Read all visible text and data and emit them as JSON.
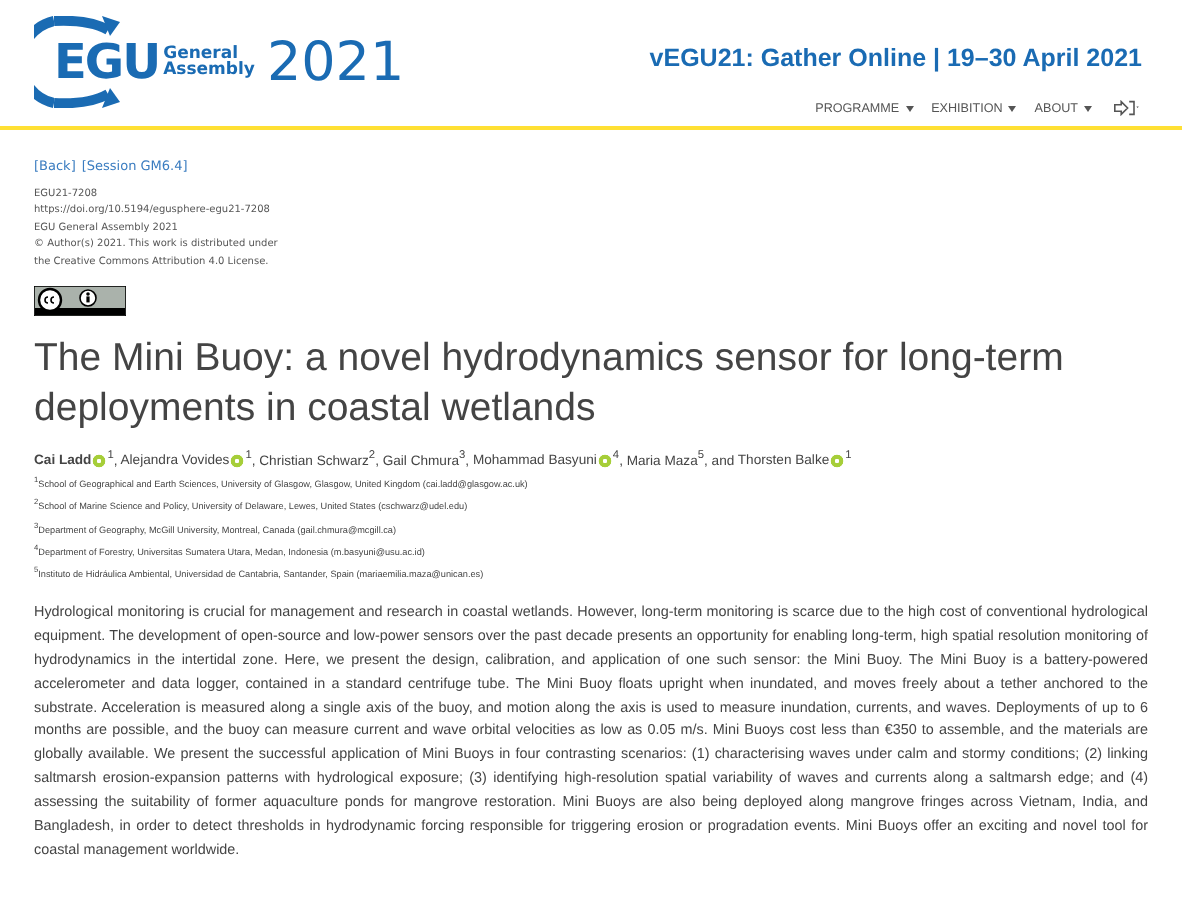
{
  "logo": {
    "letters": "EGU",
    "line_1": "General",
    "line_2": "Assembly",
    "year": "2021"
  },
  "event": "vEGU21: Gather Online | 19–30 April 2021",
  "nav": [
    {
      "label": "PROGRAMME",
      "kind": "menu"
    },
    {
      "label": "EXHIBITION",
      "kind": "menu"
    },
    {
      "label": "ABOUT",
      "kind": "menu"
    },
    {
      "kind": "login"
    }
  ],
  "links": [
    "[Back]",
    "[Session GM6.4]"
  ],
  "meta": [
    "EGU21-7208",
    "https://doi.org/10.5194/egusphere-egu21-7208",
    "EGU General Assembly 2021",
    "© Author(s) 2021. This work is distributed under",
    "the Creative Commons Attribution 4.0 License."
  ],
  "title": "The Mini Buoy: a novel hydrodynamics sensor for long-term deployments in coastal wetlands",
  "authors": [
    {
      "name": "Cai Ladd",
      "presenter": true,
      "orcid": true,
      "affiliation": "1",
      "separator": ", "
    },
    {
      "name": "Alejandra Vovides",
      "presenter": false,
      "orcid": true,
      "affiliation": "1",
      "separator": ", "
    },
    {
      "name": "Christian Schwarz",
      "presenter": false,
      "orcid": false,
      "affiliation": "2",
      "separator": ", "
    },
    {
      "name": "Gail Chmura",
      "presenter": false,
      "orcid": false,
      "affiliation": "3",
      "separator": ", "
    },
    {
      "name": "Mohammad Basyuni",
      "presenter": false,
      "orcid": true,
      "affiliation": "4",
      "separator": ", "
    },
    {
      "name": "Maria Maza",
      "presenter": false,
      "orcid": false,
      "affiliation": "5",
      "separator": ", and "
    },
    {
      "name": "Thorsten Balke",
      "presenter": false,
      "orcid": true,
      "affiliation": "1"
    }
  ],
  "affiliations": [
    {
      "number": "1",
      "text": "School of Geographical and Earth Sciences, University of Glasgow, Glasgow, United Kingdom (cai.ladd@glasgow.ac.uk)"
    },
    {
      "number": "2",
      "text": "School of Marine Science and Policy, University of Delaware, Lewes, United States (cschwarz@udel.edu)"
    },
    {
      "number": "3",
      "text": "Department of Geography, McGill University, Montreal, Canada (gail.chmura@mcgill.ca)"
    },
    {
      "number": "4",
      "text": "Department of Forestry, Universitas Sumatera Utara, Medan, Indonesia (m.basyuni@usu.ac.id)"
    },
    {
      "number": "5",
      "text": "Instituto de Hidráulica Ambiental, Universidad de Cantabria, Santander, Spain (mariaemilia.maza@unican.es)"
    }
  ],
  "abstract": "Hydrological monitoring is crucial for management and research in coastal wetlands. However, long-term monitoring is scarce due to the high cost of conventional hydrological equipment. The development of open-source and low-power sensors over the past decade presents an opportunity for enabling long-term, high spatial resolution monitoring of hydrodynamics in the intertidal zone. Here, we present the design, calibration, and application of one such sensor: the Mini Buoy. The Mini Buoy is a battery-powered accelerometer and data logger, contained in a standard centrifuge tube. The Mini Buoy floats upright when inundated, and moves freely about a tether anchored to the substrate. Acceleration is measured along a single axis of the buoy, and motion along the axis is used to measure inundation, currents, and waves. Deployments of up to 6 months are possible, and the buoy can measure current and wave orbital velocities as low as 0.05 m/s. Mini Buoys cost less than €350 to assemble, and the materials are globally available. We present the successful application of Mini Buoys in four contrasting scenarios: (1) characterising waves under calm and stormy conditions; (2) linking saltmarsh erosion-expansion patterns with hydrological exposure; (3) identifying high-resolution spatial variability of waves and currents along a saltmarsh edge; and (4) assessing the suitability of former aquaculture ponds for mangrove restoration. Mini Buoys are also being deployed along mangrove fringes across Vietnam, India, and Bangladesh, in order to detect thresholds in hydrodynamic forcing responsible for triggering erosion or progradation events. Mini Buoys offer an exciting and novel tool for coastal management worldwide."
}
